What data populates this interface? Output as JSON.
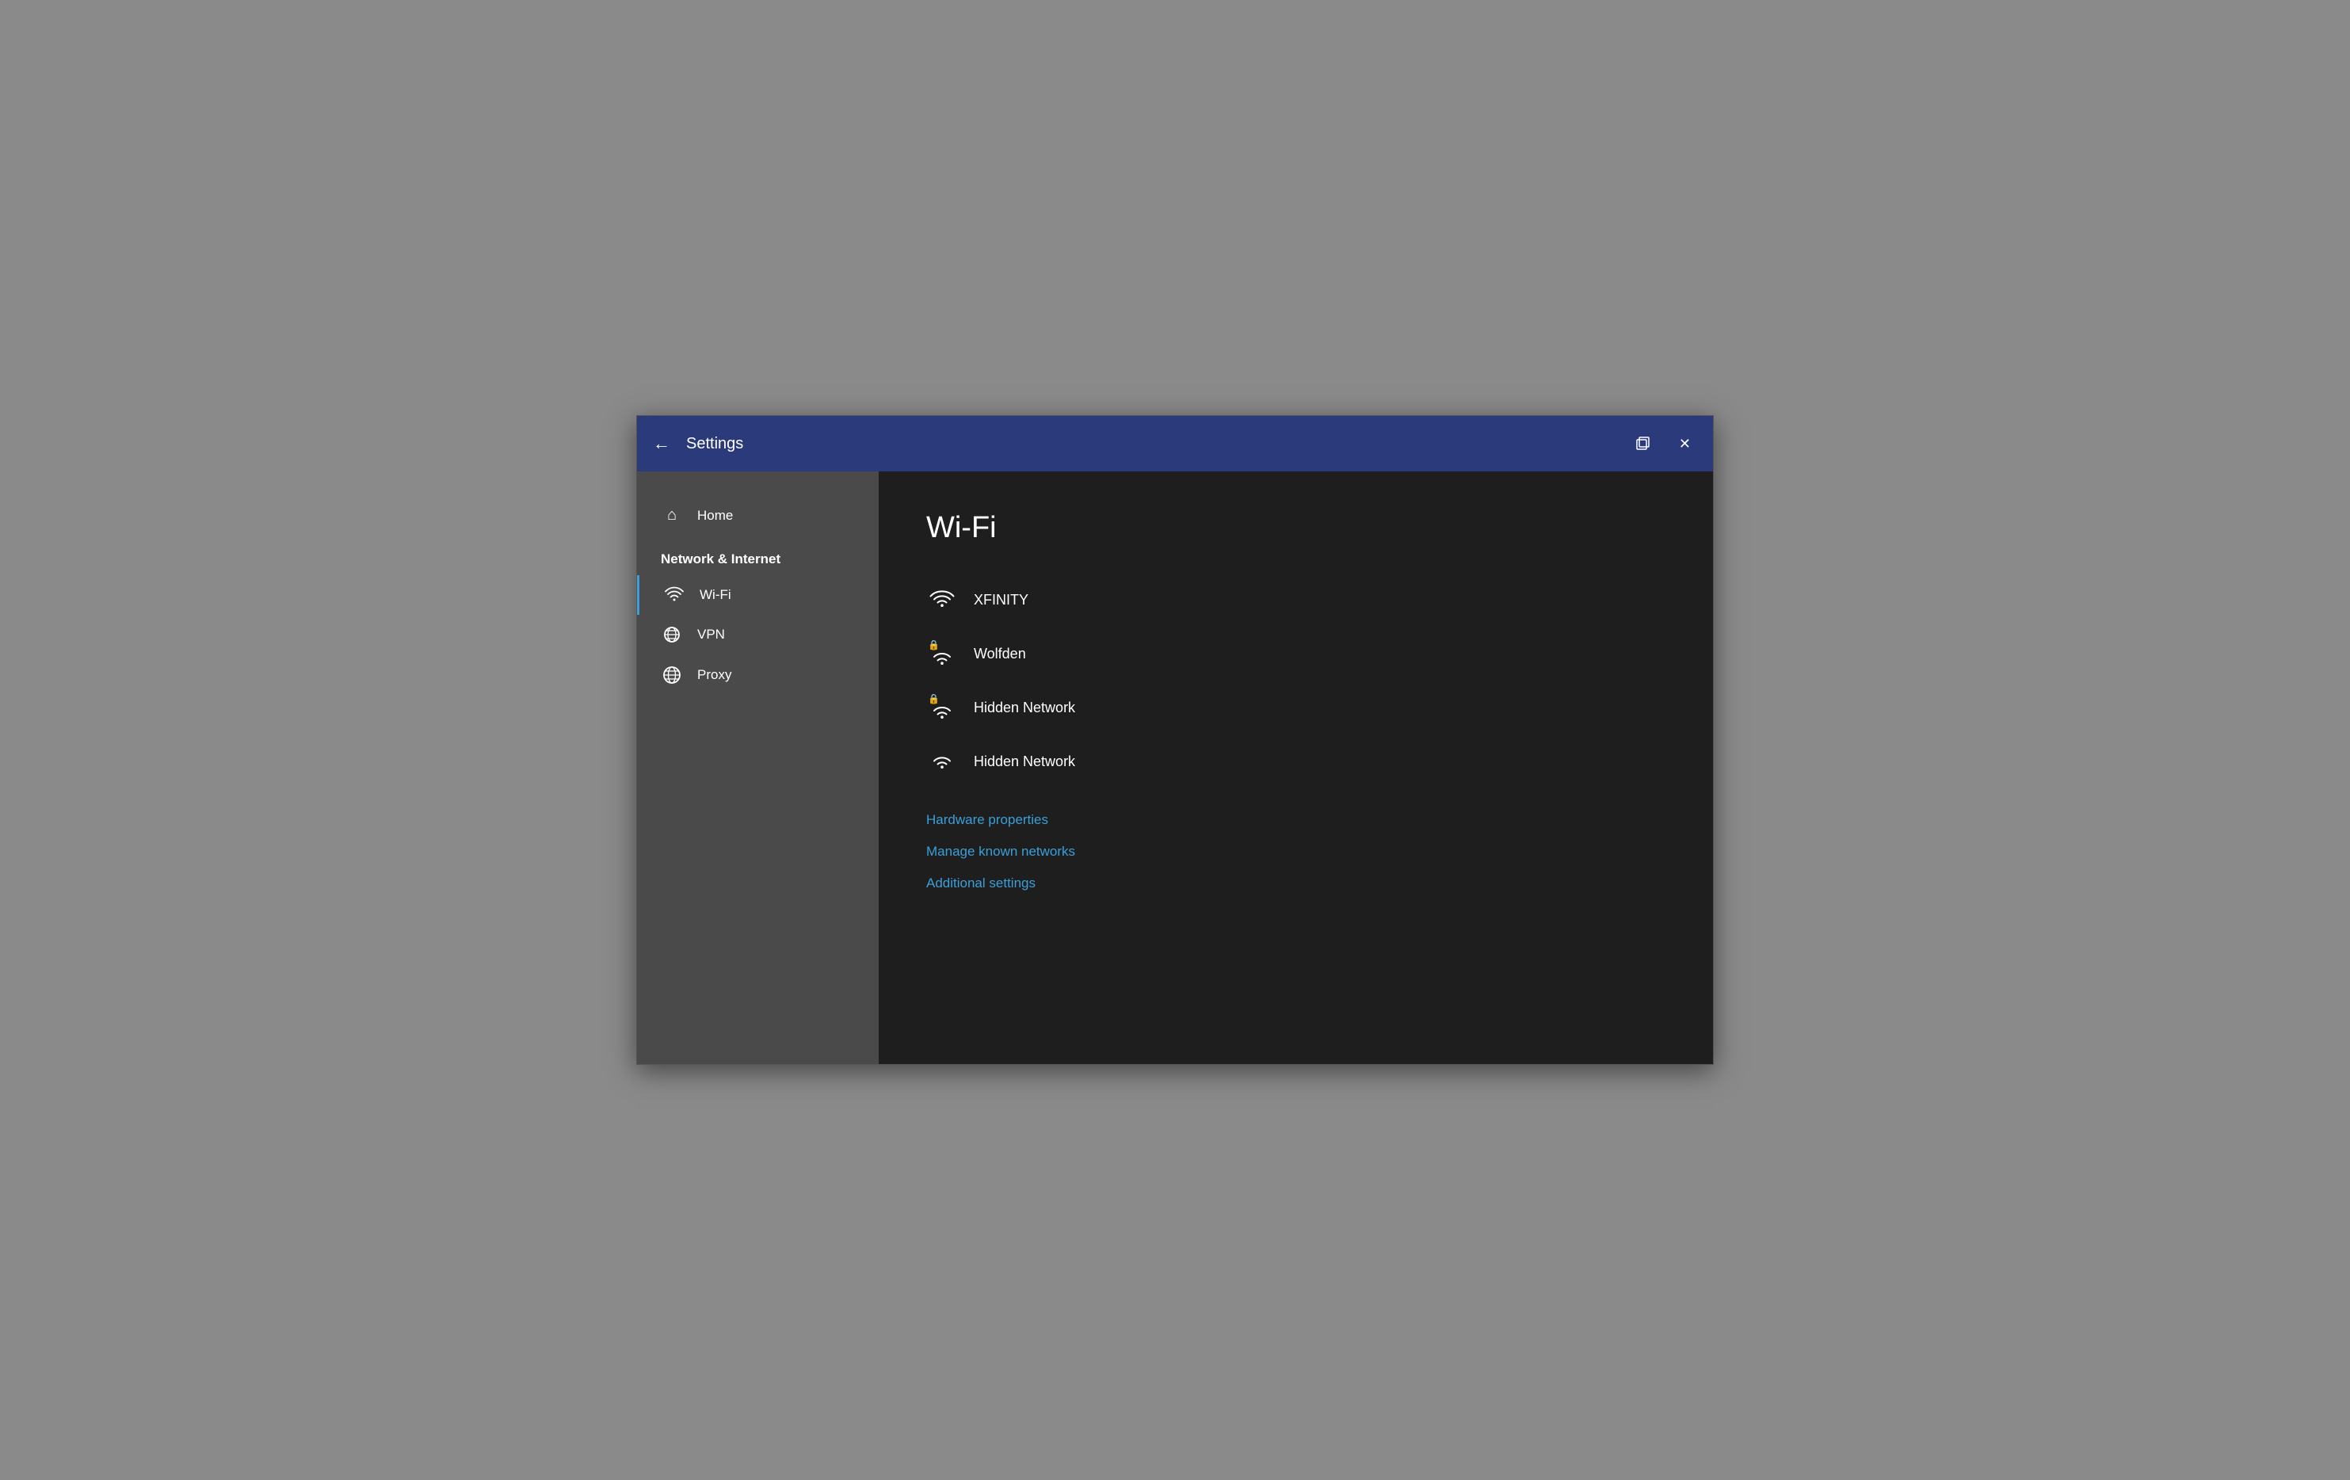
{
  "window": {
    "title": "Settings",
    "back_label": "←",
    "restore_label": "restore",
    "close_label": "✕"
  },
  "sidebar": {
    "home_label": "Home",
    "section_label": "Network & Internet",
    "items": [
      {
        "id": "wifi",
        "label": "Wi-Fi",
        "icon": "wifi",
        "active": true
      },
      {
        "id": "vpn",
        "label": "VPN",
        "icon": "vpn",
        "active": false
      },
      {
        "id": "proxy",
        "label": "Proxy",
        "icon": "globe",
        "active": false
      }
    ]
  },
  "main": {
    "title": "Wi-Fi",
    "networks": [
      {
        "id": "xfinity",
        "name": "XFINITY",
        "secured": false
      },
      {
        "id": "wolfden",
        "name": "Wolfden",
        "secured": true
      },
      {
        "id": "hidden1",
        "name": "Hidden Network",
        "secured": true
      },
      {
        "id": "hidden2",
        "name": "Hidden Network",
        "secured": false
      }
    ],
    "links": [
      {
        "id": "hardware",
        "label": "Hardware properties"
      },
      {
        "id": "manage",
        "label": "Manage known networks"
      },
      {
        "id": "additional",
        "label": "Additional settings"
      }
    ]
  }
}
